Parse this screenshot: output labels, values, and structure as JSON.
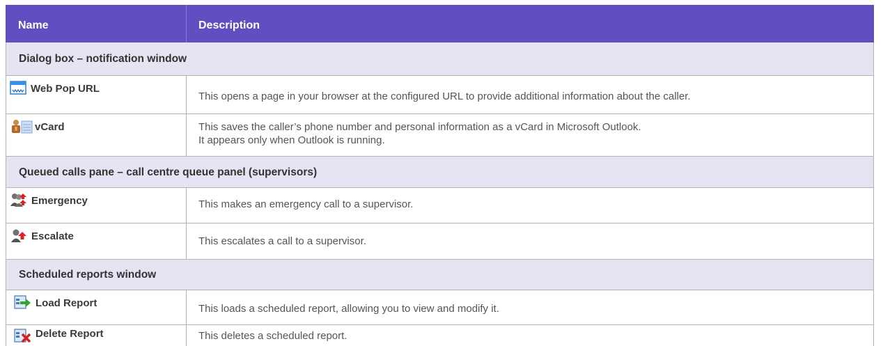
{
  "header": {
    "name": "Name",
    "description": "Description"
  },
  "sections": [
    {
      "title": "Dialog box – notification window",
      "items": [
        {
          "icon": "web-pop-icon",
          "name": "Web Pop URL",
          "description": "This opens a page in your browser at the configured URL to provide additional information about the caller."
        },
        {
          "icon": "vcard-icon",
          "name": "vCard",
          "description": "This saves the caller’s phone number and personal information as a vCard in Microsoft Outlook.",
          "description2": "It appears only when Outlook is running."
        }
      ]
    },
    {
      "title": "Queued calls pane – call centre queue panel (supervisors)",
      "items": [
        {
          "icon": "emergency-icon",
          "name": "Emergency",
          "description": "This makes an emergency call to a supervisor."
        },
        {
          "icon": "escalate-icon",
          "name": "Escalate",
          "description": "This escalates a call to a supervisor."
        }
      ]
    },
    {
      "title": "Scheduled reports window",
      "items": [
        {
          "icon": "load-report-icon",
          "name": "Load Report",
          "description": "This loads a scheduled report, allowing you to view and modify it."
        },
        {
          "icon": "delete-report-icon",
          "name": "Delete Report",
          "description": "This deletes a scheduled report."
        }
      ]
    }
  ],
  "colors": {
    "header_bg": "#604fc1",
    "section_bg": "#e4e4f3",
    "border": "#b3b3b3"
  }
}
